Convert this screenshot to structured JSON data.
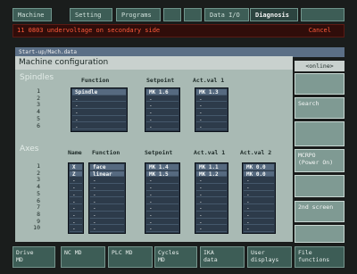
{
  "top_tabs": [
    {
      "label": "Machine",
      "active": false
    },
    {
      "label": "Setting",
      "active": false
    },
    {
      "label": "Programs",
      "active": false
    },
    {
      "label": "",
      "active": false
    },
    {
      "label": "",
      "active": false
    },
    {
      "label": "Data I/O",
      "active": false
    },
    {
      "label": "Diagnosis",
      "active": true
    },
    {
      "label": "",
      "active": false
    }
  ],
  "alarm": {
    "text": "11 0803 undervoltage on secondary side",
    "cancel_label": "Cancel"
  },
  "path": "Start-up/Mach.data",
  "title": "Machine configuration",
  "spindles": {
    "section_label": "Spindles",
    "headers": {
      "function": "Function",
      "setpoint": "Setpoint",
      "actval1": "Act.val 1"
    },
    "row_numbers": [
      "1",
      "2",
      "3",
      "4",
      "5",
      "6"
    ],
    "function": [
      "Spindle",
      "-",
      "-",
      "-",
      "-",
      "-"
    ],
    "setpoint": [
      "MK 1.6",
      "-",
      "-",
      "-",
      "-",
      "-"
    ],
    "actval1": [
      "MK 1.3",
      "-",
      "-",
      "-",
      "-",
      "-"
    ]
  },
  "axes": {
    "section_label": "Axes",
    "headers": {
      "name": "Name",
      "function": "Function",
      "setpoint": "Setpoint",
      "actval1": "Act.val 1",
      "actval2": "Act.val 2"
    },
    "row_numbers": [
      "1",
      "2",
      "3",
      "4",
      "5",
      "6",
      "7",
      "8",
      "9",
      "10"
    ],
    "name": [
      "X",
      "Z",
      "-",
      "-",
      "-",
      "-",
      "-",
      "-",
      "-",
      "-"
    ],
    "function": [
      "face",
      "linear",
      "-",
      "-",
      "-",
      "-",
      "-",
      "-",
      "-",
      "-"
    ],
    "setpoint": [
      "MK 1.4",
      "MK 1.5",
      "-",
      "-",
      "-",
      "-",
      "-",
      "-",
      "-",
      "-"
    ],
    "actval1": [
      "MK 1.1",
      "MK 1.2",
      "-",
      "-",
      "-",
      "-",
      "-",
      "-",
      "-",
      "-"
    ],
    "actval2": [
      "MK 0.0",
      "MK 0.0",
      "-",
      "-",
      "-",
      "-",
      "-",
      "-",
      "-",
      "-"
    ]
  },
  "right_softkeys": {
    "online": "<online>",
    "blank1": "",
    "search": "Search",
    "blank2": "",
    "mcrpo": "MCRPO",
    "mcrpo_sub": "(Power On)",
    "blank3": "",
    "second_screen": "2nd screen",
    "blank4": ""
  },
  "bottom_softkeys": [
    {
      "l1": "Drive",
      "l2": "MD"
    },
    {
      "l1": "NC MD",
      "l2": ""
    },
    {
      "l1": "PLC MD",
      "l2": ""
    },
    {
      "l1": "Cycles",
      "l2": "MD"
    },
    {
      "l1": "IKA",
      "l2": "data"
    },
    {
      "l1": "User",
      "l2": "displays"
    },
    {
      "l1": "File",
      "l2": "functions"
    }
  ]
}
